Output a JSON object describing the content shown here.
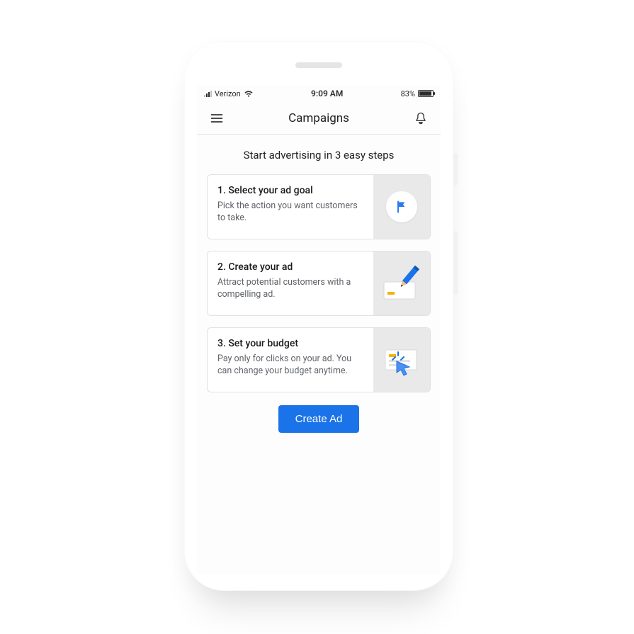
{
  "status": {
    "carrier": "Verizon",
    "time": "9:09 AM",
    "battery_pct": "83%"
  },
  "header": {
    "title": "Campaigns"
  },
  "main": {
    "heading": "Start advertising in 3 easy steps",
    "steps": [
      {
        "title": "1. Select your ad goal",
        "desc": "Pick the action you want customers to take.",
        "icon": "flag-icon"
      },
      {
        "title": "2. Create your ad",
        "desc": "Attract potential customers with a compelling ad.",
        "icon": "pencil-card-icon"
      },
      {
        "title": "3. Set your budget",
        "desc": "Pay only for clicks on your ad. You can change your budget anytime.",
        "icon": "cursor-card-icon"
      }
    ],
    "cta_label": "Create Ad"
  },
  "colors": {
    "accent": "#1a73e8",
    "googleBlue": "#2a7af2",
    "grayPanel": "#e9e9e9"
  }
}
